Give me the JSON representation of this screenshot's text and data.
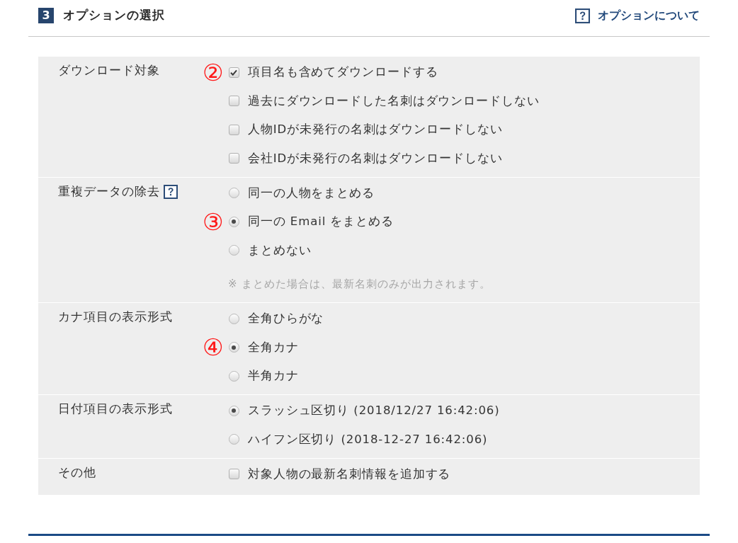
{
  "section": {
    "number": "3",
    "title": "オプションの選択",
    "help_link": "オプションについて"
  },
  "options": [
    {
      "label": "ダウンロード対象",
      "help": false,
      "kind": "checkbox",
      "choices": [
        {
          "label": "項目名も含めてダウンロードする",
          "checked": true,
          "marker": "②"
        },
        {
          "label": "過去にダウンロードした名刺はダウンロードしない",
          "checked": false
        },
        {
          "label": "人物IDが未発行の名刺はダウンロードしない",
          "checked": false
        },
        {
          "label": "会社IDが未発行の名刺はダウンロードしない",
          "checked": false
        }
      ]
    },
    {
      "label": "重複データの除去",
      "help": true,
      "kind": "radio",
      "choices": [
        {
          "label": "同一の人物をまとめる",
          "selected": false
        },
        {
          "label": "同一の Email をまとめる",
          "selected": true,
          "marker": "③"
        },
        {
          "label": "まとめない",
          "selected": false
        }
      ],
      "note": "※ まとめた場合は、最新名刺のみが出力されます。"
    },
    {
      "label": "カナ項目の表示形式",
      "help": false,
      "kind": "radio",
      "choices": [
        {
          "label": "全角ひらがな",
          "selected": false
        },
        {
          "label": "全角カナ",
          "selected": true,
          "marker": "④"
        },
        {
          "label": "半角カナ",
          "selected": false
        }
      ]
    },
    {
      "label": "日付項目の表示形式",
      "help": false,
      "kind": "radio",
      "choices": [
        {
          "label": "スラッシュ区切り (2018/12/27 16:42:06)",
          "selected": true
        },
        {
          "label": "ハイフン区切り (2018-12-27 16:42:06)",
          "selected": false
        }
      ]
    },
    {
      "label": "その他",
      "help": false,
      "kind": "checkbox",
      "choices": [
        {
          "label": "対象人物の最新名刺情報を追加する",
          "checked": false
        }
      ]
    }
  ]
}
